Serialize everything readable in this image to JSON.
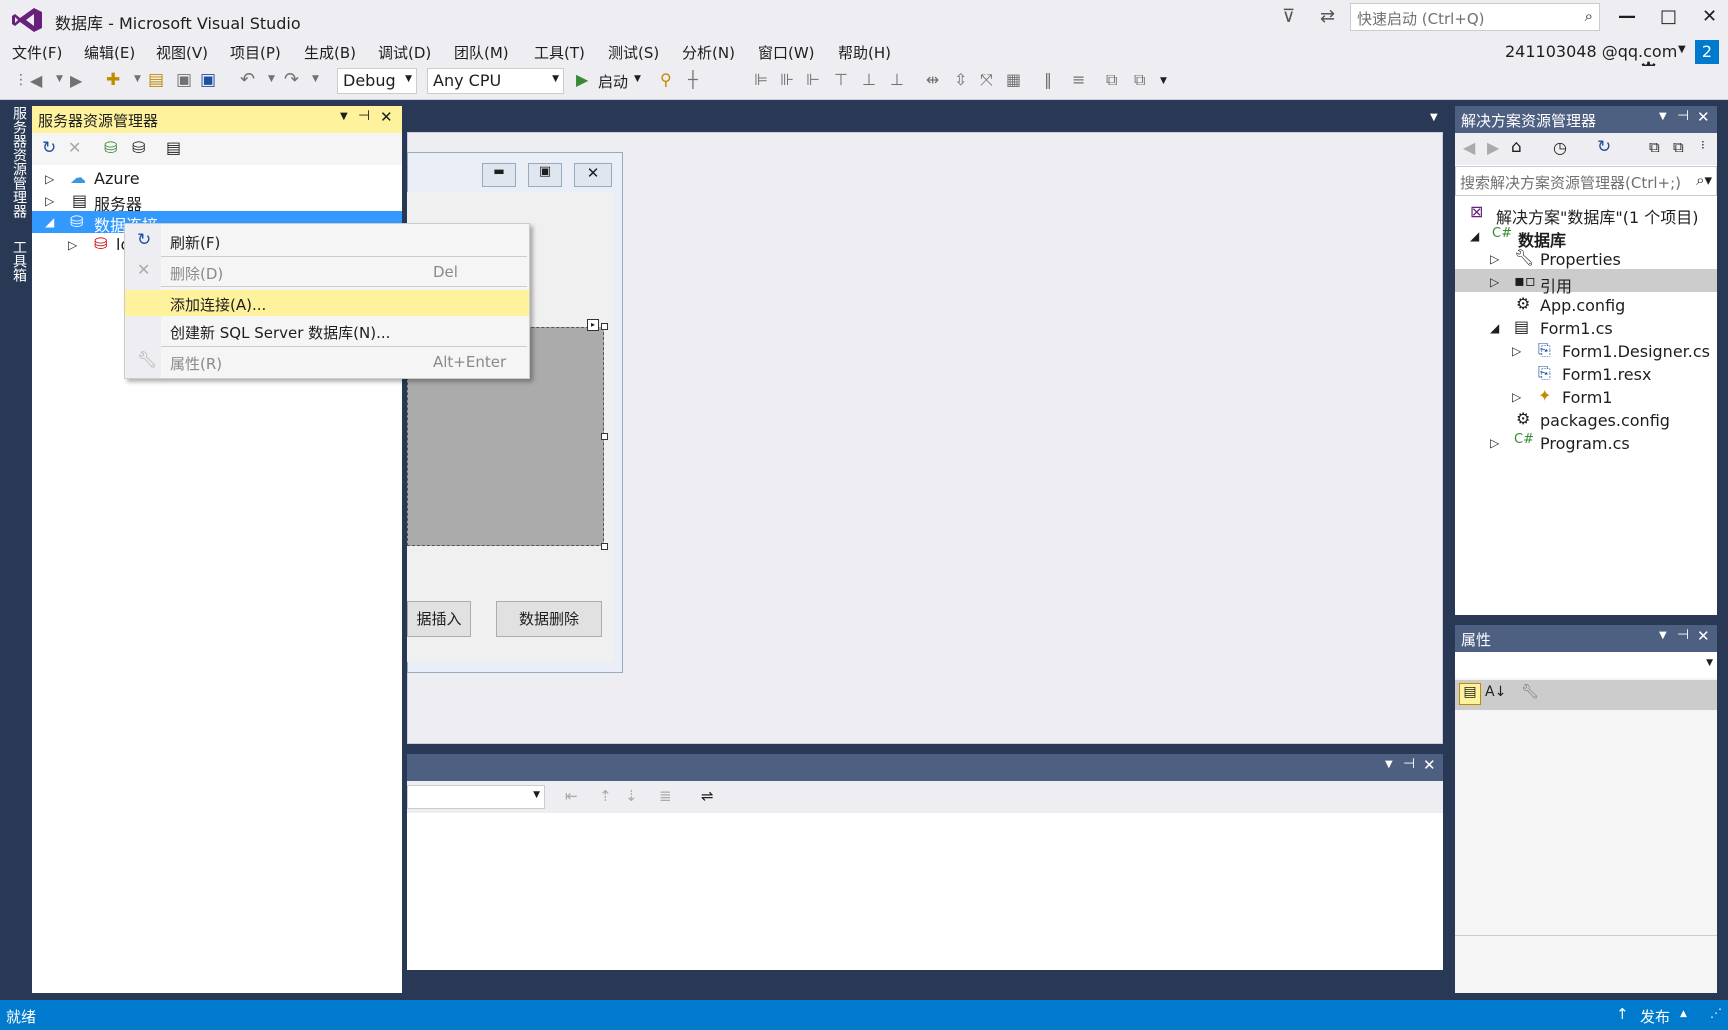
{
  "window": {
    "title": "数据库 - Microsoft Visual Studio",
    "quick_launch_placeholder": "快速启动 (Ctrl+Q)",
    "account": "241103048 @qq.com",
    "notification_count": "2"
  },
  "menu": [
    "文件(F)",
    "编辑(E)",
    "视图(V)",
    "项目(P)",
    "生成(B)",
    "调试(D)",
    "团队(M)",
    "工具(T)",
    "测试(S)",
    "分析(N)",
    "窗口(W)",
    "帮助(H)"
  ],
  "toolbar": {
    "config": "Debug",
    "platform": "Any CPU",
    "start_label": "启动"
  },
  "left_tabs": [
    "服务器资源管理器",
    "工具箱"
  ],
  "server_explorer": {
    "title": "服务器资源管理器",
    "tree": [
      {
        "label": "Azure",
        "expanded": false
      },
      {
        "label": "服务器",
        "expanded": false
      },
      {
        "label": "数据连接",
        "expanded": true,
        "selected": true
      },
      {
        "label": "lo",
        "expanded": false
      }
    ]
  },
  "context_menu": [
    {
      "label": "刷新(F)",
      "shortcut": "",
      "enabled": true,
      "highlighted": false
    },
    {
      "label": "删除(D)",
      "shortcut": "Del",
      "enabled": false,
      "highlighted": false
    },
    {
      "label": "添加连接(A)...",
      "shortcut": "",
      "enabled": true,
      "highlighted": true
    },
    {
      "label": "创建新 SQL Server 数据库(N)...",
      "shortcut": "",
      "enabled": true,
      "highlighted": false
    },
    {
      "label": "属性(R)",
      "shortcut": "Alt+Enter",
      "enabled": false,
      "highlighted": false
    }
  ],
  "form": {
    "button_insert": "据插入",
    "button_delete": "数据删除"
  },
  "solution_explorer": {
    "title": "解决方案资源管理器",
    "search_placeholder": "搜索解决方案资源管理器(Ctrl+;)",
    "solution": "解决方案\"数据库\"(1 个项目)",
    "project": "数据库",
    "items": [
      "Properties",
      "引用",
      "App.config",
      "Form1.cs",
      "Form1.Designer.cs",
      "Form1.resx",
      "Form1",
      "packages.config",
      "Program.cs"
    ]
  },
  "properties": {
    "title": "属性"
  },
  "status": {
    "left": "就绪",
    "publish": "发布"
  },
  "colors": {
    "accent": "#007acc",
    "chrome": "#eeeef2",
    "frame": "#293955",
    "highlight": "#fff29d",
    "inactive_title": "#4d6082"
  }
}
